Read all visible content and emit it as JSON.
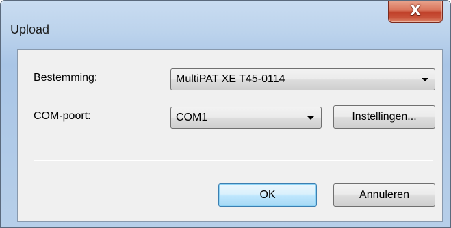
{
  "window": {
    "title": "Upload",
    "close_label": "X"
  },
  "form": {
    "destination_label": "Bestemming:",
    "destination_value": "MultiPAT XE T45-0114",
    "com_port_label": "COM-poort:",
    "com_port_value": "COM1",
    "settings_button": "Instellingen..."
  },
  "footer": {
    "ok_button": "OK",
    "cancel_button": "Annuleren"
  },
  "icons": {
    "close": "close-icon",
    "dropdown": "chevron-down-icon"
  }
}
